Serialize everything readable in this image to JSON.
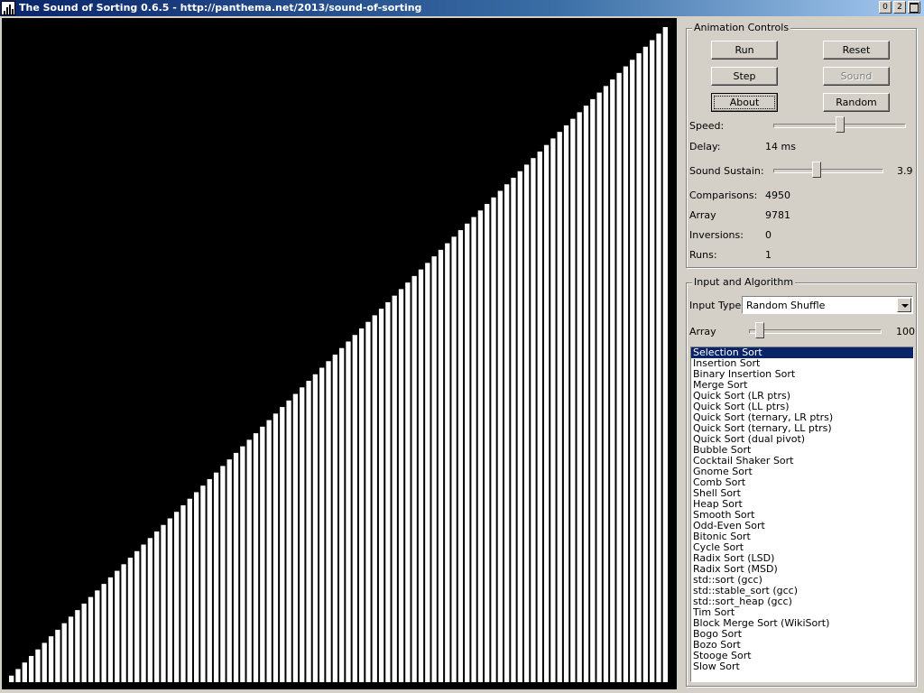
{
  "window": {
    "title": "The Sound of Sorting 0.6.5 - http://panthema.net/2013/sound-of-sorting",
    "buttons": [
      "0",
      "2",
      ""
    ]
  },
  "array_view": {
    "values": [
      1,
      2,
      3,
      4,
      5,
      6,
      7,
      8,
      9,
      10,
      11,
      12,
      13,
      14,
      15,
      16,
      17,
      18,
      19,
      20,
      21,
      22,
      23,
      24,
      25,
      26,
      27,
      28,
      29,
      30,
      31,
      32,
      33,
      34,
      35,
      36,
      37,
      38,
      39,
      40,
      41,
      42,
      43,
      44,
      45,
      46,
      47,
      48,
      49,
      50,
      51,
      52,
      53,
      54,
      55,
      56,
      57,
      58,
      59,
      60,
      61,
      62,
      63,
      64,
      65,
      66,
      67,
      68,
      69,
      70,
      71,
      72,
      73,
      74,
      75,
      76,
      77,
      78,
      79,
      80,
      81,
      82,
      83,
      84,
      85,
      86,
      87,
      88,
      89,
      90,
      91,
      92,
      93,
      94,
      95,
      96,
      97,
      98,
      99,
      100
    ],
    "max_value": 100,
    "bar_color": "#ffffff",
    "background_color": "#000000"
  },
  "animation_controls": {
    "group_label": "Animation Controls",
    "buttons": {
      "run": "Run",
      "reset": "Reset",
      "step": "Step",
      "sound": "Sound",
      "about": "About",
      "random": "Random"
    },
    "speed_label": "Speed:",
    "speed_fraction": 0.5,
    "delay_label": "Delay:",
    "delay_value": "14 ms",
    "sustain_label": "Sound Sustain:",
    "sustain_fraction": 0.39,
    "sustain_value": "3.9",
    "stats": [
      {
        "label": "Comparisons:",
        "value": "4950"
      },
      {
        "label": "Array",
        "value": "9781"
      },
      {
        "label": "Inversions:",
        "value": "0"
      },
      {
        "label": "Runs:",
        "value": "1"
      }
    ]
  },
  "input_algorithm": {
    "group_label": "Input and Algorithm",
    "input_type_label": "Input Type:",
    "input_type_value": "Random Shuffle",
    "array_label": "Array",
    "array_size_fraction": 0.08,
    "array_size_value": "100",
    "selected_index": 0,
    "algorithms": [
      "Selection Sort",
      "Insertion Sort",
      "Binary Insertion Sort",
      "Merge Sort",
      "Quick Sort (LR ptrs)",
      "Quick Sort (LL ptrs)",
      "Quick Sort (ternary, LR ptrs)",
      "Quick Sort (ternary, LL ptrs)",
      "Quick Sort (dual pivot)",
      "Bubble Sort",
      "Cocktail Shaker Sort",
      "Gnome Sort",
      "Comb Sort",
      "Shell Sort",
      "Heap Sort",
      "Smooth Sort",
      "Odd-Even Sort",
      "Bitonic Sort",
      "Cycle Sort",
      "Radix Sort (LSD)",
      "Radix Sort (MSD)",
      "std::sort (gcc)",
      "std::stable_sort (gcc)",
      "std::sort_heap (gcc)",
      "Tim Sort",
      "Block Merge Sort (WikiSort)",
      "Bogo Sort",
      "Bozo Sort",
      "Stooge Sort",
      "Slow Sort"
    ]
  }
}
